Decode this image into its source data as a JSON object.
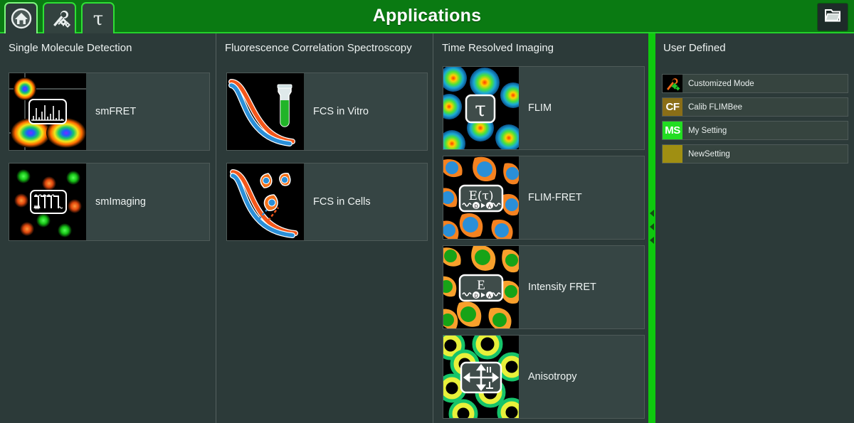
{
  "header": {
    "title": "Applications",
    "tabs": [
      {
        "name": "home-tab",
        "icon": "home-icon",
        "active": true
      },
      {
        "name": "tools-tab",
        "icon": "wrench-gear-icon",
        "active": false
      },
      {
        "name": "tau-tab",
        "icon": "tau-icon",
        "active": false
      }
    ],
    "open_button": {
      "label": "",
      "icon": "open-folder-icon"
    }
  },
  "columns": [
    {
      "heading": "Single Molecule Detection",
      "tiles": [
        {
          "label": "smFRET",
          "icon": "fret-heatmap-icon"
        },
        {
          "label": "smImaging",
          "icon": "sm-dots-trace-icon"
        }
      ]
    },
    {
      "heading": "Fluorescence Correlation Spectroscopy",
      "tiles": [
        {
          "label": "FCS in Vitro",
          "icon": "fcs-curve-tube-icon"
        },
        {
          "label": "FCS in Cells",
          "icon": "fcs-curve-cells-icon"
        }
      ]
    },
    {
      "heading": "Time Resolved Imaging",
      "tiles": [
        {
          "label": "FLIM",
          "icon": "flim-tau-icon"
        },
        {
          "label": "FLIM-FRET",
          "icon": "flim-fret-icon",
          "badge_text": "E(τ)"
        },
        {
          "label": "Intensity FRET",
          "icon": "intensity-fret-icon",
          "badge_text": "E"
        },
        {
          "label": "Anisotropy",
          "icon": "anisotropy-arrows-icon"
        }
      ]
    }
  ],
  "user_defined": {
    "heading": "User Defined",
    "items": [
      {
        "label": "Customized Mode",
        "swatch_text": "",
        "swatch_color": "#000000",
        "icon": "wrench-gear-icon"
      },
      {
        "label": "Calib FLIMBee",
        "swatch_text": "CF",
        "swatch_color": "#8a6e17"
      },
      {
        "label": "My Setting",
        "swatch_text": "MS",
        "swatch_color": "#22dd22"
      },
      {
        "label": "NewSetting",
        "swatch_text": "",
        "swatch_color": "#a08f12"
      }
    ]
  },
  "colors": {
    "header_green": "#0a7a12",
    "accent_green": "#23d12a",
    "splitter_green": "#0ec90e",
    "background": "#2c3a39",
    "tile_body": "#364544"
  },
  "splitter": {
    "name": "panel-splitter",
    "arrow_glyph": "◀"
  }
}
